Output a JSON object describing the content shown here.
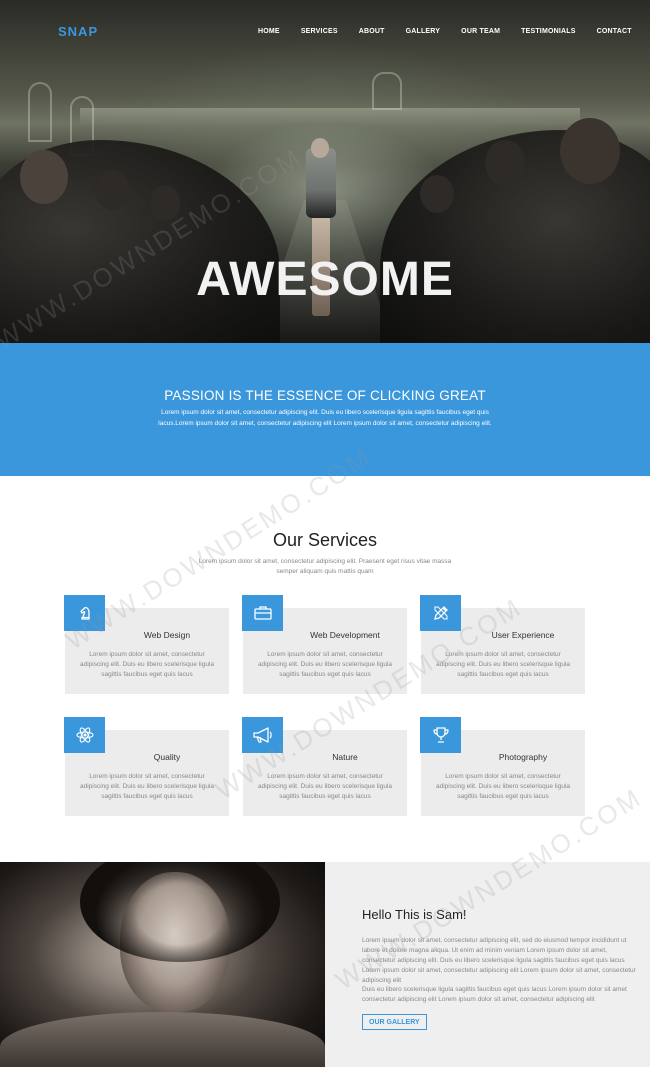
{
  "brand": {
    "logo": "SNAP",
    "accent": "#3a97dc"
  },
  "nav": {
    "items": [
      "HOME",
      "SERVICES",
      "ABOUT",
      "GALLERY",
      "OUR TEAM",
      "TESTIMONIALS",
      "CONTACT"
    ]
  },
  "hero": {
    "title": "AWESOME"
  },
  "band": {
    "heading": "PASSION IS THE ESSENCE OF CLICKING GREAT",
    "text": "Lorem ipsum dolor sit amet, consectetur adipiscing elit. Duis eu libero scelerisque ligula sagittis faucibus eget quis lacus.Lorem ipsum dolor sit amet, consectetur adipiscing elit Lorem ipsum dolor sit amet, consectetur adipiscing elit."
  },
  "services": {
    "title": "Our Services",
    "subtitle": "Lorem ipsum dolor sit amet, consectetur adipiscing elit. Praesent eget risus vitae massa semper aliquam quis mattis quam",
    "cards": [
      {
        "title": "Web Design",
        "icon": "chess-knight-icon",
        "text": "Lorem ipsum dolor sit amet, consectetur adipiscing elit. Duis eu libero scelerisque ligula sagittis faucibus eget quis lacus"
      },
      {
        "title": "Web Development",
        "icon": "briefcase-icon",
        "text": "Lorem ipsum dolor sit amet, consectetur adipiscing elit. Duis eu libero scelerisque ligula sagittis faucibus eget quis lacus"
      },
      {
        "title": "User Experience",
        "icon": "pencil-ruler-icon",
        "text": "Lorem ipsum dolor sit amet, consectetur adipiscing elit. Duis eu libero scelerisque ligula sagittis faucibus eget quis lacus"
      },
      {
        "title": "Quality",
        "icon": "atom-icon",
        "text": "Lorem ipsum dolor sit amet, consectetur adipiscing elit. Duis eu libero scelerisque ligula sagittis faucibus eget quis lacus"
      },
      {
        "title": "Nature",
        "icon": "megaphone-icon",
        "text": "Lorem ipsum dolor sit amet, consectetur adipiscing elit. Duis eu libero scelerisque ligula sagittis faucibus eget quis lacus"
      },
      {
        "title": "Photography",
        "icon": "trophy-icon",
        "text": "Lorem ipsum dolor sit amet, consectetur adipiscing elit. Duis eu libero scelerisque ligula sagittis faucibus eget quis lacus"
      }
    ]
  },
  "about": {
    "heading": "Hello This is Sam!",
    "para1": "Lorem ipsum dolor sit amet, consectetur adipiscing elit, sed do eiusmod tempor incididunt ut labore et dolore magna aliqua. Ut enim ad minim veniam Lorem ipsum dolor sit amet, consectetur adipiscing elit. Duis eu libero scelerisque ligula sagittis faucibus eget quis lacus Lorem ipsum dolor sit amet, consectetur adipiscing elit Lorem ipsum dolor sit amet, consectetur adipiscing elit",
    "para2": "Duis eu libero scelerisque ligula sagittis faucibus eget quis lacus Lorem ipsum dolor sit amet consectetur adipiscing elit Lorem ipsum dolor sit amet, consectetur adipiscing elit",
    "button": "OUR GALLERY"
  },
  "watermark": "WWW.DOWNDEMO.COM"
}
